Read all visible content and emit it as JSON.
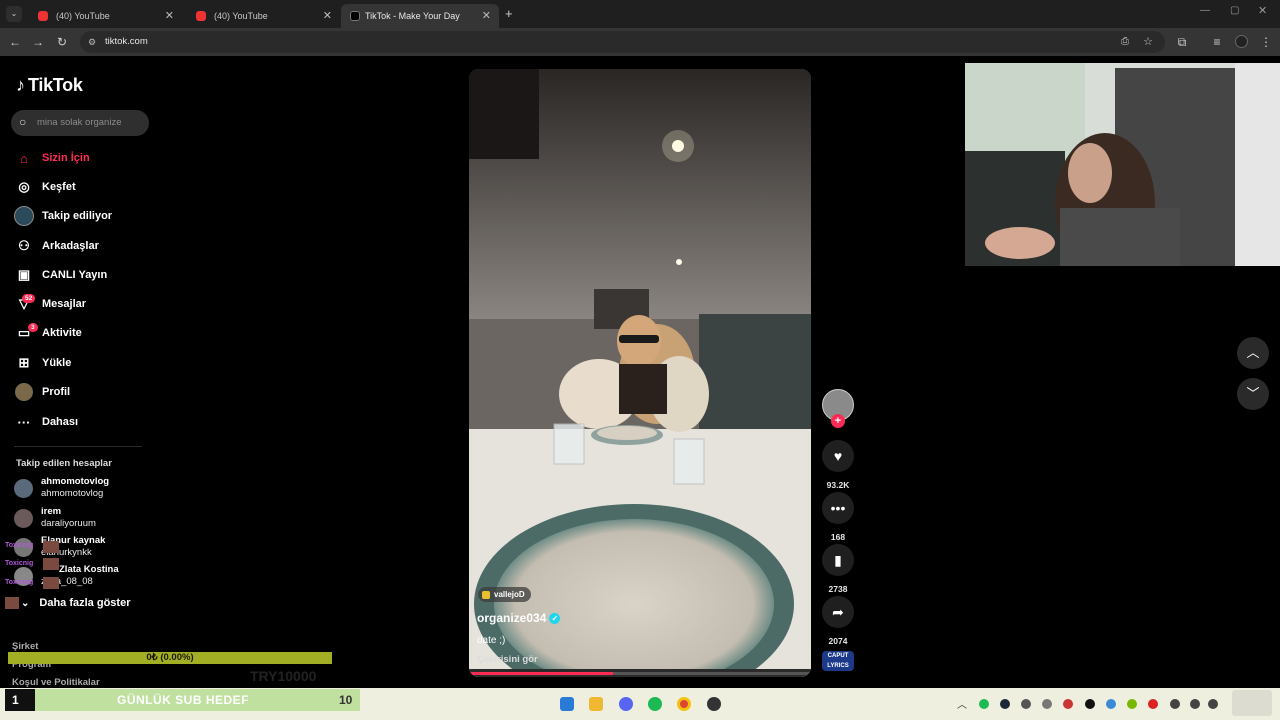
{
  "browser": {
    "tabs": [
      {
        "title": "(40) YouTube",
        "active": false
      },
      {
        "title": "(40) YouTube",
        "active": false
      },
      {
        "title": "TikTok - Make Your Day",
        "active": true
      }
    ],
    "url": "tiktok.com"
  },
  "sidebar": {
    "logo": "TikTok",
    "search_placeholder": "mina solak organize",
    "nav": [
      {
        "label": "Sizin İçin",
        "icon": "home-icon"
      },
      {
        "label": "Keşfet",
        "icon": "compass-icon"
      },
      {
        "label": "Takip ediliyor",
        "icon": "following-icon"
      },
      {
        "label": "Arkadaşlar",
        "icon": "friends-icon"
      },
      {
        "label": "CANLI Yayın",
        "icon": "live-icon"
      },
      {
        "label": "Mesajlar",
        "icon": "messages-icon",
        "badge": "52"
      },
      {
        "label": "Aktivite",
        "icon": "activity-icon",
        "badge": "3"
      },
      {
        "label": "Yükle",
        "icon": "upload-icon"
      },
      {
        "label": "Profil",
        "icon": "profile-icon"
      },
      {
        "label": "Dahası",
        "icon": "more-icon"
      }
    ],
    "following_header": "Takip edilen hesaplar",
    "following": [
      {
        "name": "ahmomotovlog",
        "handle": "ahmomotovlog"
      },
      {
        "name": "irem",
        "handle": "daraliyoruum"
      },
      {
        "name": "Elanur kaynak",
        "handle": "elanurkynkk"
      },
      {
        "name": "Zlata Kostina",
        "handle": "zlata_08_08"
      }
    ],
    "show_more": "Daha fazla göster",
    "footer": [
      "Şirket",
      "Program",
      "Koşul ve Politikalar"
    ]
  },
  "overlay": {
    "sub_goal_progress": "0₺ (0.00%)",
    "sub_goal_progress_fraction": 0.0,
    "sub_goal_label": "GÜNLÜK SUB HEDEF",
    "sub_goal_left": "1",
    "sub_goal_target": "10",
    "toxic_tags": [
      "Toxicnig",
      "Toxicnig",
      "Toxicnig"
    ],
    "try_goal": "TRY10000"
  },
  "video": {
    "sticker": "vallejoD",
    "author": "organize034",
    "caption": "date ;)",
    "translate": "Çevirisini gör",
    "progress": 0.42
  },
  "actions": {
    "likes": "93.2K",
    "comments": "168",
    "saves": "2738",
    "shares": "2074",
    "music_badge": "CAPUT LYRICS"
  },
  "colors": {
    "accent": "#fe2c55",
    "verified": "#20d5ec",
    "goal_bar": "#a2ae24"
  }
}
